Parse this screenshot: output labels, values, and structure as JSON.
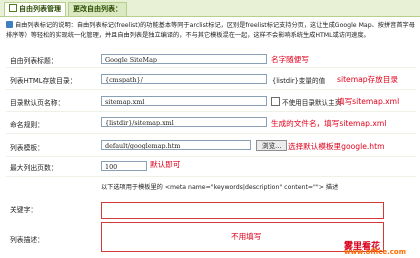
{
  "tabs": [
    {
      "label": "自由列表管理"
    },
    {
      "label": "更改自由列表："
    }
  ],
  "notice": "自由列表标记的说明：自由列表标记(freelist)的功能基本等同于arclist标记，区别是freelist标记支持分页，这让生成Google Map、按拼音首字母排序等）等轻松的实现统一化管理，并且自由列表是独立编译的，不与其它模板混在一起，这样不会影响系统生成HTML或访问速度。",
  "form": {
    "title": {
      "label": "自由列表标题：",
      "value": "Google SiteMap",
      "hint": "名字随便写"
    },
    "dir": {
      "label": "列表HTML存放目录：",
      "value": "{cmspath}/",
      "suffix": "{listdir}变量的值",
      "hint": "sitemap存放目录"
    },
    "default_page": {
      "label": "目录默认页名称：",
      "value": "sitemap.xml",
      "checkbox_label": "不使用目录默认主页",
      "hint": "填写sitemap.xml"
    },
    "naming": {
      "label": "命名规则：",
      "value": "{listdir}/sitemap.xml",
      "hint": "生成的文件名，填写sitemap.xml"
    },
    "template": {
      "label": "列表模板：",
      "value": "default/googlemap.htm",
      "browse_label": "浏览...",
      "hint": "选择默认模板里google.htm"
    },
    "max_pages": {
      "label": "最大列出页数：",
      "value": "100",
      "hint": "默认即可"
    },
    "meta_note": "以下选项用于模板里的 <meta name=\"keywords|description\" content=\"\"> 描述",
    "keywords": {
      "label": "关键字："
    },
    "description": {
      "label": "列表描述："
    },
    "no_fill_hint": "不用填写"
  },
  "watermark": {
    "cn": "雾里看花",
    "url": "www.office.com"
  }
}
